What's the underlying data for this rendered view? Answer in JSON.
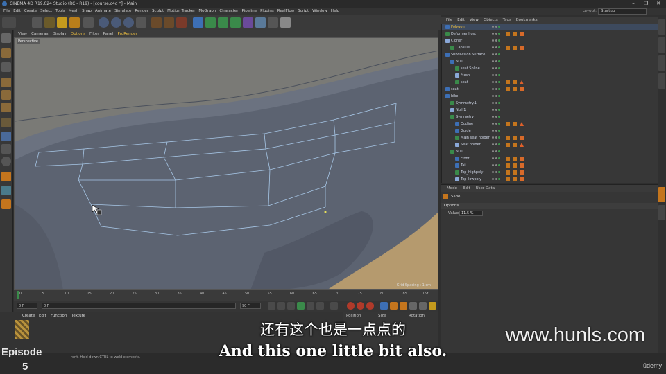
{
  "window": {
    "title": "CINEMA 4D R19.024 Studio (RC - R19) - [course.c4d *] - Main"
  },
  "menubar": [
    "File",
    "Edit",
    "Create",
    "Select",
    "Tools",
    "Mesh",
    "Snap",
    "Animate",
    "Simulate",
    "Render",
    "Sculpt",
    "Motion Tracker",
    "MoGraph",
    "Character",
    "Pipeline",
    "Plugins",
    "RealFlow",
    "Script",
    "Window",
    "Help"
  ],
  "layout": {
    "label": "Layout:",
    "value": "Startup"
  },
  "viewport": {
    "menu": [
      "View",
      "Cameras",
      "Display",
      "Options",
      "Filter",
      "Panel",
      "ProRender"
    ],
    "label": "Perspective",
    "grid_spacing": "Grid Spacing : 1 cm"
  },
  "timeline": {
    "ticks": [
      "0",
      "5",
      "10",
      "15",
      "20",
      "25",
      "30",
      "35",
      "40",
      "45",
      "50",
      "55",
      "60",
      "65",
      "70",
      "75",
      "80",
      "85",
      "90"
    ],
    "end_label": "0 F"
  },
  "transport": {
    "start": "0 F",
    "current": "0 F",
    "mid": "90 F",
    "end": "90 F"
  },
  "material": {
    "menu": [
      "Create",
      "Edit",
      "Function",
      "Texture"
    ]
  },
  "coords": {
    "headers": [
      "Position",
      "Size",
      "Rotation"
    ]
  },
  "object_manager": {
    "menu": [
      "File",
      "Edit",
      "View",
      "Objects",
      "Tags",
      "Bookmarks"
    ],
    "items": [
      {
        "name": "Polygon",
        "indent": 0,
        "highlight": true
      },
      {
        "name": "Deformer host",
        "indent": 0
      },
      {
        "name": "Cloner",
        "indent": 0
      },
      {
        "name": "Capsule",
        "indent": 1
      },
      {
        "name": "Subdivision Surface",
        "indent": 0
      },
      {
        "name": "Null",
        "indent": 1
      },
      {
        "name": "seat Spline",
        "indent": 2
      },
      {
        "name": "Mesh",
        "indent": 2
      },
      {
        "name": "seat",
        "indent": 2
      },
      {
        "name": "seat",
        "indent": 0
      },
      {
        "name": "bike",
        "indent": 0
      },
      {
        "name": "Symmetry.1",
        "indent": 1
      },
      {
        "name": "Null.1",
        "indent": 1
      },
      {
        "name": "Symmetry",
        "indent": 1
      },
      {
        "name": "Outline",
        "indent": 2
      },
      {
        "name": "Guide",
        "indent": 2
      },
      {
        "name": "Main seat holder",
        "indent": 2
      },
      {
        "name": "Seat holder",
        "indent": 2
      },
      {
        "name": "Null",
        "indent": 1
      },
      {
        "name": "Front",
        "indent": 2
      },
      {
        "name": "Tail",
        "indent": 2
      },
      {
        "name": "Top_highpoly",
        "indent": 2
      },
      {
        "name": "Top_lowpoly",
        "indent": 2
      }
    ]
  },
  "attributes": {
    "menu": [
      "Mode",
      "Edit",
      "User Data"
    ],
    "object": "Slide",
    "tab": "Options",
    "value_label": "Value",
    "value": "11.5 %"
  },
  "status_text": "rent. Hold down CTRL to weld elements.",
  "overlay": {
    "subtitle_cn": "还有这个也是一点点的",
    "subtitle_en": "And this one little bit also.",
    "watermark": "www.hunls.com",
    "episode": "Episode",
    "episode_num": "5",
    "udemy": "ūdemy"
  },
  "colors": {
    "accent": "#3d6fb5",
    "viewport_bg": "#7a7a76",
    "mesh": "#5c6371",
    "edges": "#a8c8e8"
  }
}
